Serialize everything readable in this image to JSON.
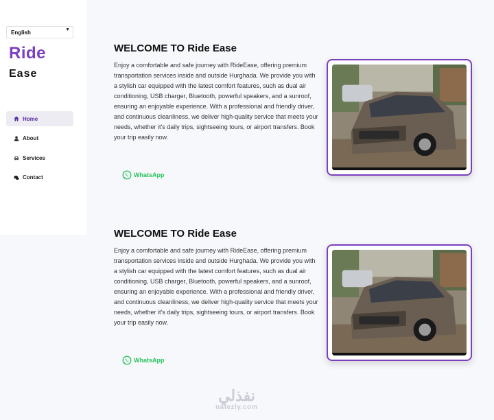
{
  "language_select": {
    "value": "English"
  },
  "brand": {
    "line1": "Ride",
    "line2": "Ease",
    "color": "#7b3fbf"
  },
  "nav": {
    "items": [
      {
        "label": "Home",
        "icon": "home-icon",
        "active": true
      },
      {
        "label": "About",
        "icon": "user-icon",
        "active": false
      },
      {
        "label": "Services",
        "icon": "car-icon",
        "active": false
      },
      {
        "label": "Contact",
        "icon": "chat-icon",
        "active": false
      }
    ]
  },
  "sections": [
    {
      "title": "WELCOME TO Ride Ease",
      "body": "Enjoy a comfortable and safe journey with RideEase, offering premium transportation services inside and outside Hurghada. We provide you with a stylish car equipped with the latest comfort features, such as dual air conditioning, USB charger, Bluetooth, powerful speakers, and a sunroof, ensuring an enjoyable experience. With a professional and friendly driver, and continuous cleanliness, we deliver high-quality service that meets your needs, whether it's daily trips, sightseeing tours, or airport transfers. Book your trip easily now.",
      "whatsapp_label": "WhatsApp"
    },
    {
      "title": "WELCOME TO Ride Ease",
      "body": "Enjoy a comfortable and safe journey with RideEase, offering premium transportation services inside and outside Hurghada. We provide you with a stylish car equipped with the latest comfort features, such as dual air conditioning, USB charger, Bluetooth, powerful speakers, and a sunroof, ensuring an enjoyable experience. With a professional and friendly driver, and continuous cleanliness, we deliver high-quality service that meets your needs, whether it's daily trips, sightseeing tours, or airport transfers. Book your trip easily now.",
      "whatsapp_label": "WhatsApp"
    }
  ],
  "watermark": {
    "arabic": "نفذلي",
    "latin": "nafezly.com"
  },
  "colors": {
    "accent": "#7b3fbf",
    "whatsapp": "#25c35a",
    "background": "#f7f8fb"
  }
}
